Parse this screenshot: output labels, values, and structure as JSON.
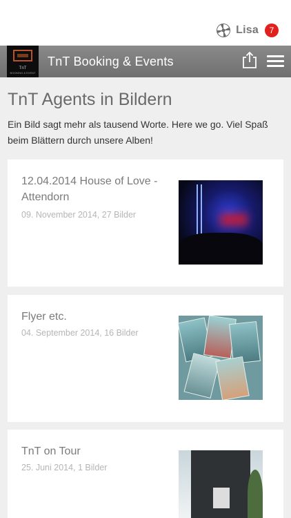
{
  "user": {
    "name": "Lisa",
    "badge_count": "7",
    "logo_icon": "pinwheel-logo-icon"
  },
  "navbar": {
    "title": "TnT Booking & Events",
    "logo_line1": "TnT",
    "logo_line2": "BOOKING & EVENT",
    "share_icon": "share-icon",
    "menu_icon": "hamburger-menu-icon"
  },
  "page": {
    "title": "TnT Agents in Bildern",
    "intro": "Ein Bild sagt mehr als tausend Worte. Here we go. Viel Spaß beim Blättern durch unsere Alben!"
  },
  "albums": [
    {
      "title": "12.04.2014 House of Love - Attendorn",
      "meta": "09. November 2014, 27 Bilder"
    },
    {
      "title": "Flyer etc.",
      "meta": "04. September 2014, 16 Bilder"
    },
    {
      "title": "TnT on Tour",
      "meta": "25. Juni 2014, 1 Bilder"
    }
  ],
  "colors": {
    "badge": "#e0211d",
    "navbar": "#7d7d7d",
    "background": "#efefef"
  }
}
